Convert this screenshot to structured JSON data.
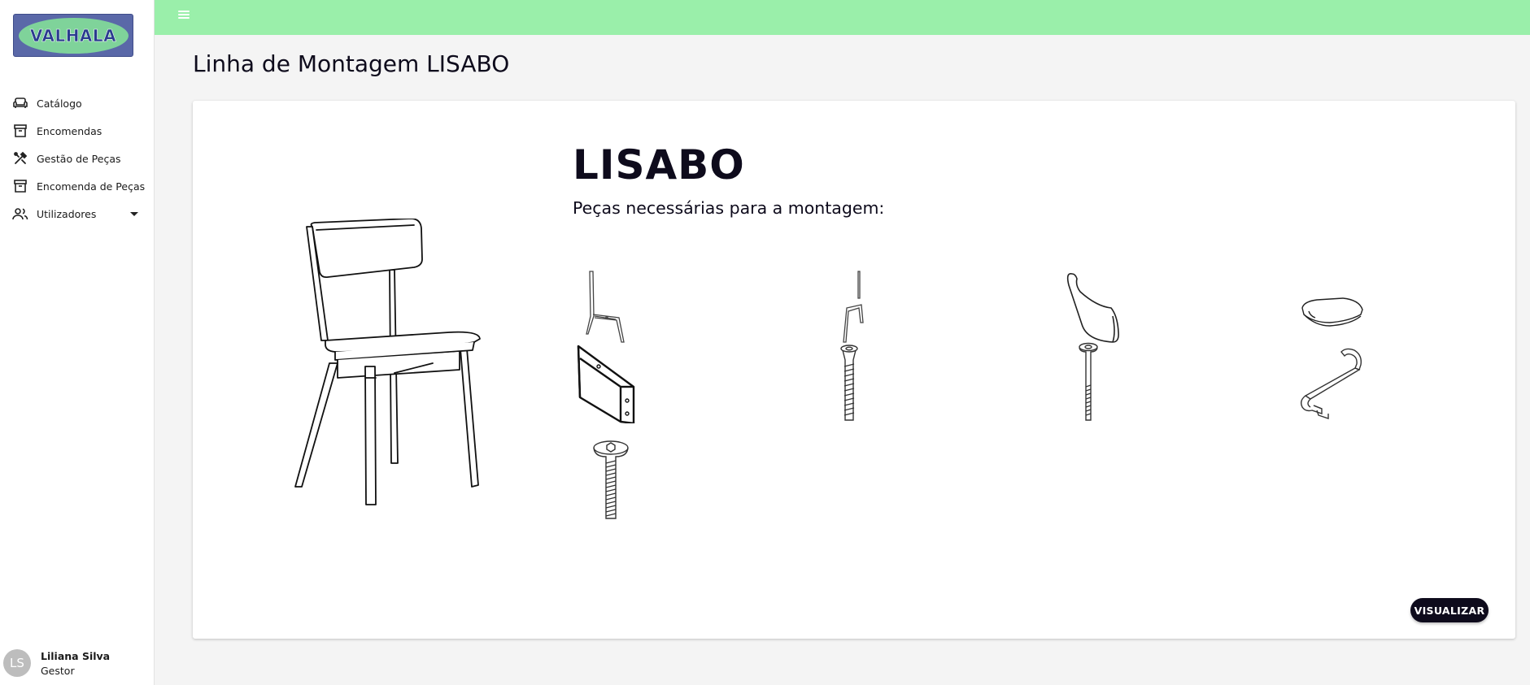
{
  "logo": {
    "text": "VALHALA"
  },
  "nav": {
    "items": [
      {
        "label": "Catálogo",
        "icon": "sofa-icon"
      },
      {
        "label": "Encomendas",
        "icon": "archive-icon"
      },
      {
        "label": "Gestão de Peças",
        "icon": "tools-icon"
      },
      {
        "label": "Encomenda de Peças",
        "icon": "archive-icon"
      },
      {
        "label": "Utilizadores",
        "icon": "users-icon",
        "expandable": true
      }
    ]
  },
  "user": {
    "initials": "LS",
    "name": "Liliana Silva",
    "role": "Gestor"
  },
  "topbar": {
    "menu_icon": "hamburger-menu-icon",
    "color": "#9aefaa"
  },
  "page": {
    "title": "Linha de Montagem LISABO"
  },
  "product": {
    "name": "LISABO",
    "parts_heading": "Peças necessárias para a montagem:",
    "image": "chair-drawing",
    "parts": [
      {
        "icon": "leg-frame-part-icon"
      },
      {
        "icon": "leg-frame-narrow-part-icon"
      },
      {
        "icon": "backrest-part-icon"
      },
      {
        "icon": "seat-part-icon"
      },
      {
        "icon": "bracket-part-icon"
      },
      {
        "icon": "dowel-part-icon"
      },
      {
        "icon": "long-bolt-part-icon"
      },
      {
        "icon": "allen-key-part-icon"
      },
      {
        "icon": "screw-part-icon"
      }
    ]
  },
  "actions": {
    "view_label": "VISUALIZAR"
  },
  "colors": {
    "accent": "#0e0b1c",
    "sidebar_bg": "#ffffff",
    "page_bg": "#f4f4f4"
  }
}
